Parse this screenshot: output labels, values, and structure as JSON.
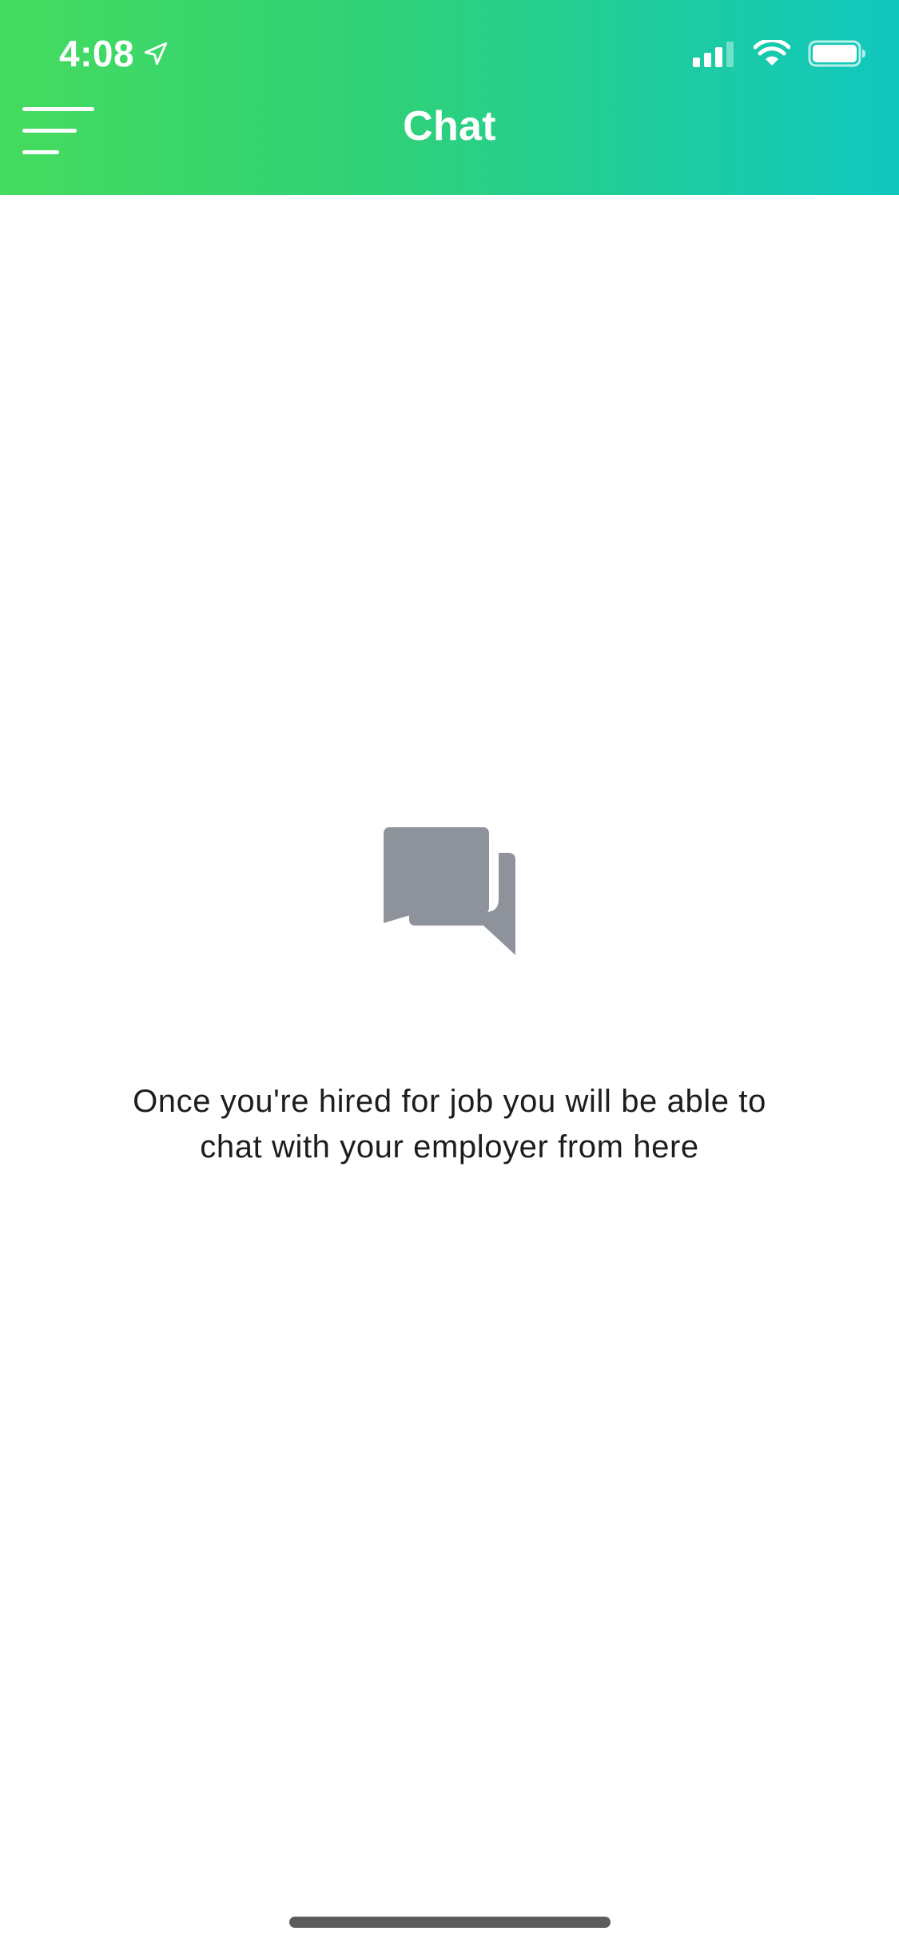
{
  "status_bar": {
    "time": "4:08",
    "icons": [
      "location-arrow-icon",
      "cellular-signal-icon",
      "wifi-icon",
      "battery-icon"
    ]
  },
  "nav": {
    "title": "Chat",
    "menu_icon": "hamburger-menu-icon"
  },
  "empty_state": {
    "icon": "chat-bubbles-icon",
    "message": "Once you're hired for job you will be able to chat with your employer from here"
  },
  "colors": {
    "header_gradient_start": "#45db5e",
    "header_gradient_end": "#10c7bf",
    "icon_gray": "#8e939b",
    "text_dark": "#1d1d1f",
    "background": "#ffffff"
  }
}
